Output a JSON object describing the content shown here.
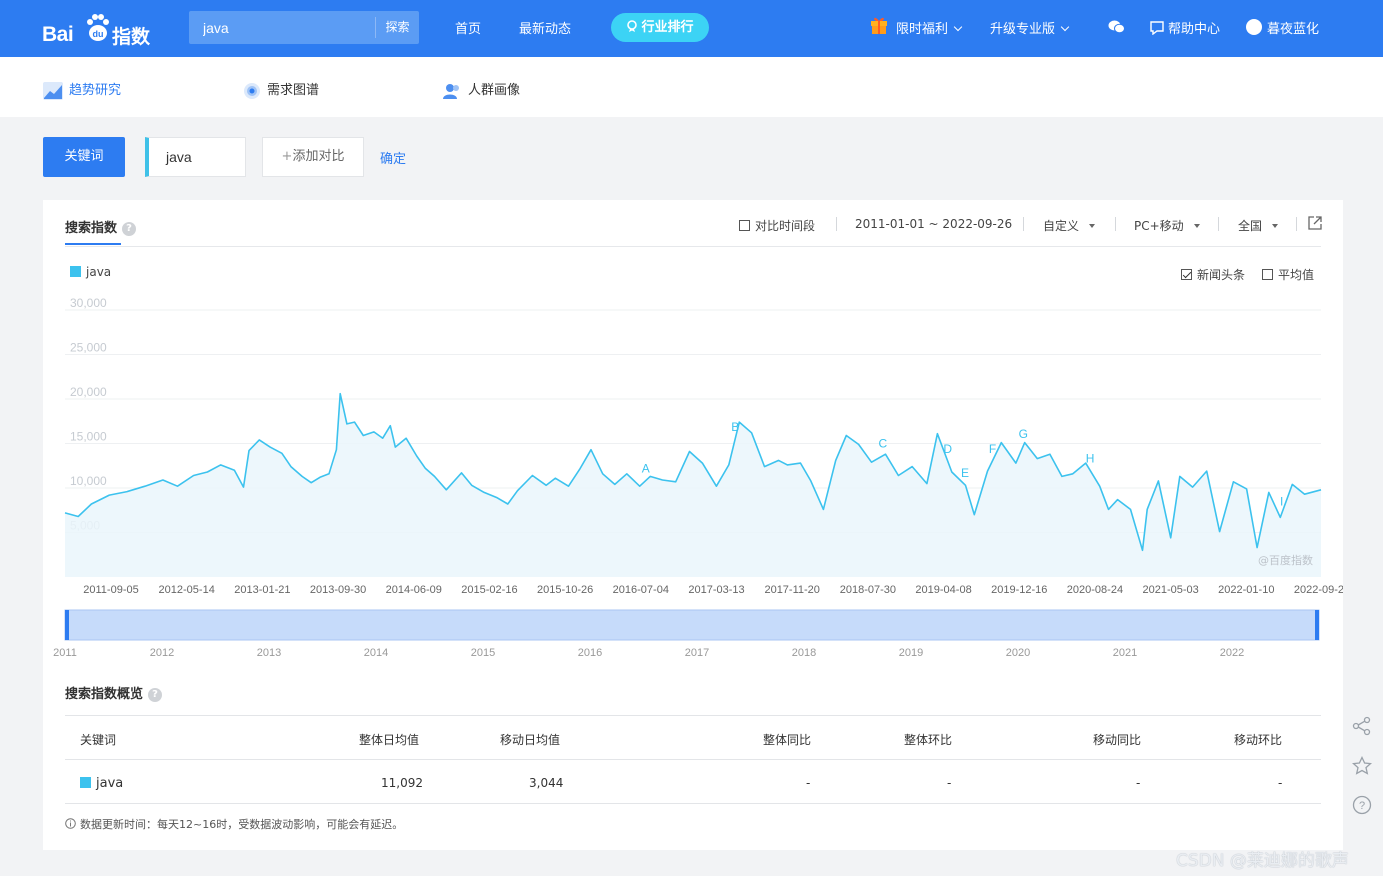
{
  "header": {
    "logo_text": "Bai",
    "logo_du": "du",
    "logo_suffix": "指数",
    "search_value": "java",
    "search_button": "探索",
    "nav": [
      "首页",
      "最新动态"
    ],
    "pill_label": "行业排行",
    "promo": "限时福利",
    "upgrade": "升级专业版",
    "help": "帮助中心",
    "user": "暮夜蓝化",
    "icons": {
      "promo": "gift-icon",
      "wechat": "wechat-icon",
      "help": "chat-bubble-icon",
      "user": "avatar-icon",
      "pill": "ranking-icon"
    }
  },
  "subtabs": [
    {
      "label": "趋势研究",
      "icon": "trend-chart-icon",
      "active": true
    },
    {
      "label": "需求图谱",
      "icon": "target-icon"
    },
    {
      "label": "人群画像",
      "icon": "people-icon"
    }
  ],
  "keyword_row": {
    "label": "关键词",
    "keyword": "java",
    "add_compare": "添加对比",
    "confirm": "确定",
    "keyword_color": "#3fc1e8"
  },
  "panel": {
    "title": "搜索指数",
    "compare_period": "对比时间段",
    "date_range": "2011-01-01 ~ 2022-09-26",
    "custom": "自定义",
    "device": "PC+移动",
    "region": "全国",
    "news_headlines": "新闻头条",
    "news_checked": true,
    "average": "平均值",
    "average_checked": false,
    "export_icon": "export-icon",
    "watermark": "@百度指数"
  },
  "colors": {
    "accent": "#2d7cf1",
    "series": "#3cc2ee",
    "pill": "#3cd3f5"
  },
  "chart_data": {
    "type": "area",
    "series": [
      {
        "name": "java"
      }
    ],
    "ylim": [
      0,
      30000
    ],
    "yticks": [
      "30,000",
      "25,000",
      "20,000",
      "15,000",
      "10,000",
      "5,000"
    ],
    "ytick_values": [
      30000,
      25000,
      20000,
      15000,
      10000,
      5000
    ],
    "xticks": [
      "2011-09-05",
      "2012-05-14",
      "2013-01-21",
      "2013-09-30",
      "2014-06-09",
      "2015-02-16",
      "2015-10-26",
      "2016-07-04",
      "2017-03-13",
      "2017-11-20",
      "2018-07-30",
      "2019-04-08",
      "2019-12-16",
      "2020-08-24",
      "2021-05-03",
      "2022-01-10",
      "2022-09-26"
    ],
    "x_range": [
      "2011-01-01",
      "2022-09-26"
    ],
    "points": [
      [
        "2011-01-01",
        7200
      ],
      [
        "2011-02-15",
        6800
      ],
      [
        "2011-04-01",
        8200
      ],
      [
        "2011-06-01",
        9200
      ],
      [
        "2011-08-01",
        9600
      ],
      [
        "2011-10-01",
        10200
      ],
      [
        "2011-12-01",
        10900
      ],
      [
        "2012-01-20",
        10200
      ],
      [
        "2012-03-15",
        11400
      ],
      [
        "2012-05-01",
        11800
      ],
      [
        "2012-06-15",
        12600
      ],
      [
        "2012-08-01",
        12000
      ],
      [
        "2012-09-01",
        10100
      ],
      [
        "2012-09-20",
        14200
      ],
      [
        "2012-10-25",
        15400
      ],
      [
        "2012-12-01",
        14600
      ],
      [
        "2013-01-10",
        13900
      ],
      [
        "2013-02-10",
        12400
      ],
      [
        "2013-03-20",
        11300
      ],
      [
        "2013-04-20",
        10600
      ],
      [
        "2013-05-20",
        11200
      ],
      [
        "2013-06-20",
        11600
      ],
      [
        "2013-07-15",
        14300
      ],
      [
        "2013-07-28",
        20600
      ],
      [
        "2013-08-20",
        17200
      ],
      [
        "2013-09-15",
        17400
      ],
      [
        "2013-10-15",
        15900
      ],
      [
        "2013-11-20",
        16300
      ],
      [
        "2013-12-20",
        15600
      ],
      [
        "2014-01-15",
        17000
      ],
      [
        "2014-02-01",
        14600
      ],
      [
        "2014-03-10",
        15600
      ],
      [
        "2014-04-15",
        13600
      ],
      [
        "2014-05-15",
        12200
      ],
      [
        "2014-06-15",
        11300
      ],
      [
        "2014-07-25",
        9800
      ],
      [
        "2014-09-15",
        11700
      ],
      [
        "2014-10-20",
        10300
      ],
      [
        "2014-12-01",
        9500
      ],
      [
        "2015-01-15",
        8900
      ],
      [
        "2015-02-20",
        8200
      ],
      [
        "2015-03-25",
        9700
      ],
      [
        "2015-05-15",
        11400
      ],
      [
        "2015-07-01",
        10300
      ],
      [
        "2015-08-01",
        11100
      ],
      [
        "2015-09-15",
        10200
      ],
      [
        "2015-10-25",
        12200
      ],
      [
        "2015-12-01",
        14300
      ],
      [
        "2016-01-10",
        11600
      ],
      [
        "2016-02-20",
        10400
      ],
      [
        "2016-04-01",
        11600
      ],
      [
        "2016-05-15",
        10200
      ],
      [
        "2016-06-20",
        11300
      ],
      [
        "2016-08-01",
        10900
      ],
      [
        "2016-09-15",
        10700
      ],
      [
        "2016-11-01",
        14100
      ],
      [
        "2016-12-15",
        12800
      ],
      [
        "2017-02-01",
        10200
      ],
      [
        "2017-03-15",
        12600
      ],
      [
        "2017-04-20",
        17400
      ],
      [
        "2017-06-01",
        16200
      ],
      [
        "2017-07-15",
        12400
      ],
      [
        "2017-09-01",
        13100
      ],
      [
        "2017-10-01",
        12600
      ],
      [
        "2017-11-15",
        12800
      ],
      [
        "2017-12-20",
        10800
      ],
      [
        "2018-02-01",
        7600
      ],
      [
        "2018-03-15",
        13100
      ],
      [
        "2018-04-20",
        15900
      ],
      [
        "2018-06-01",
        14900
      ],
      [
        "2018-07-15",
        12900
      ],
      [
        "2018-09-01",
        13800
      ],
      [
        "2018-10-15",
        11400
      ],
      [
        "2018-12-01",
        12400
      ],
      [
        "2019-01-20",
        10500
      ],
      [
        "2019-02-25",
        16100
      ],
      [
        "2019-04-15",
        11800
      ],
      [
        "2019-06-01",
        10300
      ],
      [
        "2019-07-01",
        7000
      ],
      [
        "2019-08-15",
        11900
      ],
      [
        "2019-10-01",
        15100
      ],
      [
        "2019-11-20",
        12800
      ],
      [
        "2019-12-20",
        15100
      ],
      [
        "2020-02-01",
        13300
      ],
      [
        "2020-03-15",
        13800
      ],
      [
        "2020-04-25",
        11300
      ],
      [
        "2020-06-01",
        11600
      ],
      [
        "2020-07-15",
        12800
      ],
      [
        "2020-09-01",
        10200
      ],
      [
        "2020-10-01",
        7600
      ],
      [
        "2020-11-01",
        8700
      ],
      [
        "2020-12-15",
        7600
      ],
      [
        "2021-01-25",
        3000
      ],
      [
        "2021-02-10",
        7600
      ],
      [
        "2021-03-20",
        10800
      ],
      [
        "2021-05-01",
        4400
      ],
      [
        "2021-06-01",
        11300
      ],
      [
        "2021-07-15",
        10100
      ],
      [
        "2021-09-01",
        11900
      ],
      [
        "2021-10-15",
        5100
      ],
      [
        "2021-12-01",
        10700
      ],
      [
        "2022-01-15",
        9900
      ],
      [
        "2022-02-20",
        3300
      ],
      [
        "2022-04-01",
        9500
      ],
      [
        "2022-05-10",
        6700
      ],
      [
        "2022-06-20",
        10400
      ],
      [
        "2022-08-01",
        9300
      ],
      [
        "2022-09-26",
        9800
      ]
    ],
    "annotations": [
      {
        "label": "A",
        "date": "2016-06-05"
      },
      {
        "label": "B",
        "date": "2017-04-06"
      },
      {
        "label": "C",
        "date": "2018-08-23"
      },
      {
        "label": "D",
        "date": "2019-04-01"
      },
      {
        "label": "E",
        "date": "2019-05-30"
      },
      {
        "label": "F",
        "date": "2019-09-01"
      },
      {
        "label": "G",
        "date": "2019-12-15"
      },
      {
        "label": "H",
        "date": "2020-07-30"
      },
      {
        "label": "I",
        "date": "2022-05-15"
      }
    ],
    "navigator_labels": [
      "2011",
      "2012",
      "2013",
      "2014",
      "2015",
      "2016",
      "2017",
      "2018",
      "2019",
      "2020",
      "2021",
      "2022"
    ]
  },
  "overview": {
    "title": "搜索指数概览",
    "headers": [
      "关键词",
      "整体日均值",
      "移动日均值",
      "整体同比",
      "整体环比",
      "移动同比",
      "移动环比"
    ],
    "row": [
      "java",
      "11,092",
      "3,044",
      "-",
      "-",
      "-",
      "-"
    ],
    "note": "数据更新时间：每天12~16时，受数据波动影响，可能会有延迟。"
  },
  "side_icons": [
    "share-icon",
    "star-icon",
    "help-icon"
  ],
  "watermark": "CSDN @莱迪娜的歌声"
}
